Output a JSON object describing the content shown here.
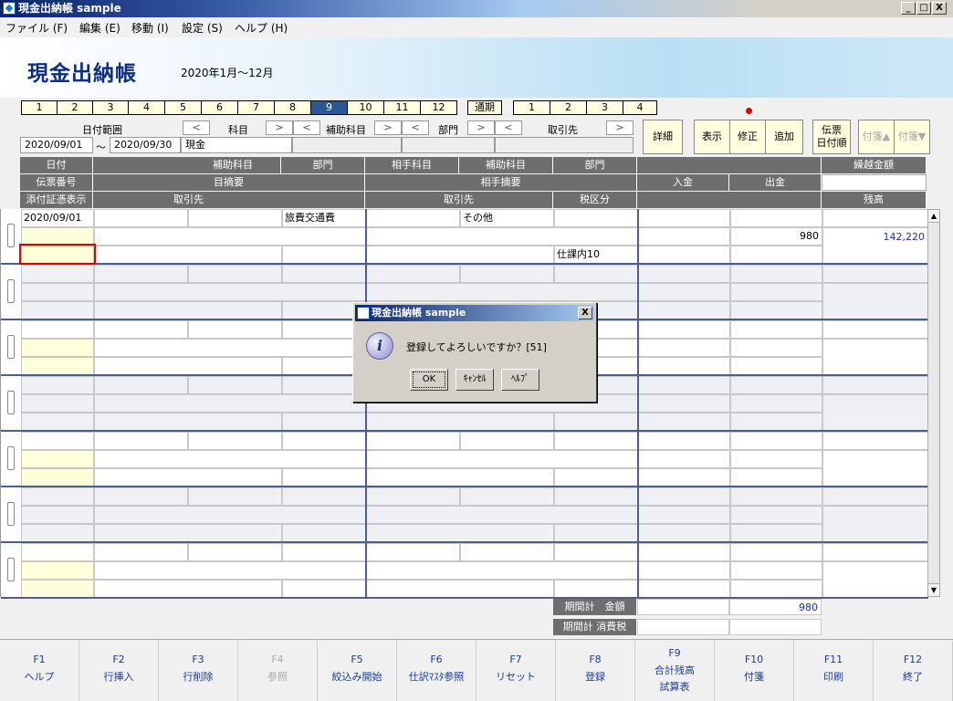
{
  "window": {
    "title": "現金出納帳 sample",
    "btn_min": "_",
    "btn_max": "□",
    "btn_close": "X"
  },
  "menu": [
    "ファイル (F)",
    "編集 (E)",
    "移動 (I)",
    "設定 (S)",
    "ヘルプ (H)"
  ],
  "banner": {
    "title": "現金出納帳",
    "period": "2020年1月～12月"
  },
  "month_tabs": [
    "1",
    "2",
    "3",
    "4",
    "5",
    "6",
    "7",
    "8",
    "9",
    "10",
    "11",
    "12"
  ],
  "active_month": "9",
  "yearly_tab": "通期",
  "quarter_tabs": [
    "1",
    "2",
    "3",
    "4"
  ],
  "filters": {
    "date_range_label": "日付範囲",
    "subject_label": "科目",
    "sub_subject_label": "補助科目",
    "dept_label": "部門",
    "partner_label": "取引先",
    "date_from": "2020/09/01",
    "tilde": "～",
    "date_to": "2020/09/30",
    "subject_value": "現金",
    "prev": "<",
    "next": ">"
  },
  "buttons": {
    "detail": "詳細",
    "display": "表示",
    "modify": "修正",
    "add": "追加",
    "voucher_line1": "伝票",
    "voucher_line2": "日付順",
    "tag_up": "付箋▲",
    "tag_down": "付箋▼"
  },
  "headers": {
    "r1": [
      "日付",
      "補助科目",
      "部門",
      "相手科目",
      "補助科目",
      "部門",
      "繰越金額"
    ],
    "r2": [
      "伝票番号",
      "目摘要",
      "相手摘要",
      "入金",
      "出金"
    ],
    "r3": [
      "添付証憑表示",
      "取引先",
      "取引先",
      "税区分",
      "残高"
    ]
  },
  "entry": {
    "date": "2020/09/01",
    "contra_account": "旅費交通費",
    "tax_category": "その他",
    "tax_detail": "仕課内10",
    "credit": "980",
    "balance": "142,220"
  },
  "totals": {
    "amount_label": "期間計　金額",
    "amount_value": "980",
    "tax_label": "期間計 消費税"
  },
  "fkeys": [
    {
      "key": "F1",
      "label": "ヘルプ",
      "label2": "",
      "disabled": false
    },
    {
      "key": "F2",
      "label": "行挿入",
      "label2": "",
      "disabled": false
    },
    {
      "key": "F3",
      "label": "行削除",
      "label2": "",
      "disabled": false
    },
    {
      "key": "F4",
      "label": "参照",
      "label2": "",
      "disabled": true
    },
    {
      "key": "F5",
      "label": "絞込み開始",
      "label2": "",
      "disabled": false
    },
    {
      "key": "F6",
      "label": "仕訳ﾏｽﾀ参照",
      "label2": "",
      "disabled": false
    },
    {
      "key": "F7",
      "label": "リセット",
      "label2": "",
      "disabled": false
    },
    {
      "key": "F8",
      "label": "登録",
      "label2": "",
      "disabled": false
    },
    {
      "key": "F9",
      "label": "合計残高",
      "label2": "試算表",
      "disabled": false
    },
    {
      "key": "F10",
      "label": "付箋",
      "label2": "",
      "disabled": false
    },
    {
      "key": "F11",
      "label": "印刷",
      "label2": "",
      "disabled": false
    },
    {
      "key": "F12",
      "label": "終了",
      "label2": "",
      "disabled": false
    }
  ],
  "dialog": {
    "title": "現金出納帳 sample",
    "message": "登録してよろしいですか？[51]",
    "ok": "OK",
    "cancel": "ｷｬﾝｾﾙ",
    "help": "ﾍﾙﾌﾟ",
    "close": "X"
  },
  "colors": {
    "accent": "#2b5797",
    "header_bg": "#6e6e6e",
    "yellow_cell": "#ffffd9",
    "balance_text": "#1a2fb0"
  }
}
